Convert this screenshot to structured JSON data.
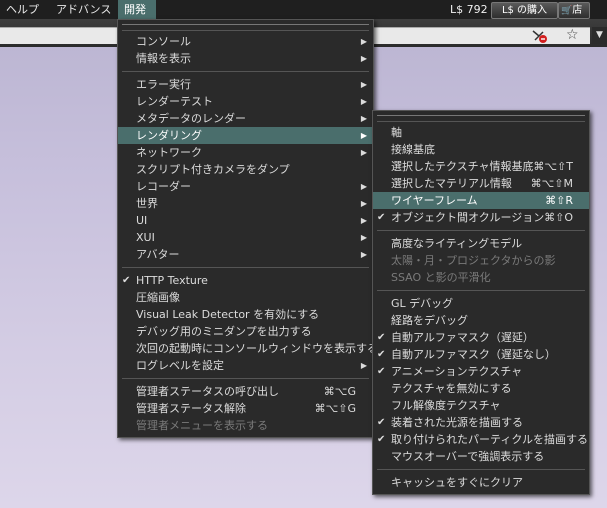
{
  "menubar": {
    "help": "ヘルプ",
    "advanced": "アドバンス",
    "develop": "開発",
    "balance": "L$ 792",
    "buy_label": "L$ の購入",
    "shop_label": "店"
  },
  "dev_menu": {
    "items": [
      {
        "label": "コンソール",
        "submenu": true
      },
      {
        "label": "情報を表示",
        "submenu": true
      },
      {
        "sep": true
      },
      {
        "label": "エラー実行",
        "submenu": true
      },
      {
        "label": "レンダーテスト",
        "submenu": true
      },
      {
        "label": "メタデータのレンダー",
        "submenu": true
      },
      {
        "label": "レンダリング",
        "submenu": true,
        "highlight": true
      },
      {
        "label": "ネットワーク",
        "submenu": true
      },
      {
        "label": "スクリプト付きカメラをダンプ"
      },
      {
        "label": "レコーダー",
        "submenu": true
      },
      {
        "label": "世界",
        "submenu": true
      },
      {
        "label": "UI",
        "submenu": true
      },
      {
        "label": "XUI",
        "submenu": true
      },
      {
        "label": "アバター",
        "submenu": true
      },
      {
        "sep": true
      },
      {
        "label": "HTTP Texture",
        "checked": true
      },
      {
        "label": "圧縮画像"
      },
      {
        "label": "Visual Leak Detector を有効にする"
      },
      {
        "label": "デバッグ用のミニダンプを出力する"
      },
      {
        "label": "次回の起動時にコンソールウィンドウを表示する"
      },
      {
        "label": "ログレベルを設定",
        "submenu": true
      },
      {
        "sep": true
      },
      {
        "label": "管理者ステータスの呼び出し",
        "shortcut": "⌘⌥G"
      },
      {
        "label": "管理者ステータス解除",
        "shortcut": "⌘⌥⇧G"
      },
      {
        "label": "管理者メニューを表示する",
        "disabled": true
      }
    ]
  },
  "render_menu": {
    "items": [
      {
        "label": "軸"
      },
      {
        "label": "接線基底"
      },
      {
        "label": "選択したテクスチャ情報基底",
        "shortcut": "⌘⌥⇧T"
      },
      {
        "label": "選択したマテリアル情報",
        "shortcut": "⌘⌥⇧M"
      },
      {
        "label": "ワイヤーフレーム",
        "shortcut": "⌘⇧R",
        "highlight": true
      },
      {
        "label": "オブジェクト間オクルージョン",
        "shortcut": "⌘⇧O",
        "checked": true
      },
      {
        "sep": true
      },
      {
        "label": "高度なライティングモデル"
      },
      {
        "label": "太陽・月・プロジェクタからの影",
        "disabled": true
      },
      {
        "label": "SSAO と影の平滑化",
        "disabled": true
      },
      {
        "sep": true
      },
      {
        "label": "GL デバッグ"
      },
      {
        "label": "経路をデバッグ"
      },
      {
        "label": "自動アルファマスク（遅延）",
        "checked": true
      },
      {
        "label": "自動アルファマスク（遅延なし）",
        "checked": true
      },
      {
        "label": "アニメーションテクスチャ",
        "checked": true
      },
      {
        "label": "テクスチャを無効にする"
      },
      {
        "label": "フル解像度テクスチャ"
      },
      {
        "label": "装着された光源を描画する",
        "checked": true
      },
      {
        "label": "取り付けられたパーティクルを描画する",
        "checked": true
      },
      {
        "label": "マウスオーバーで強調表示する"
      },
      {
        "sep": true
      },
      {
        "label": "キャッシュをすぐにクリア"
      }
    ]
  },
  "glyphs": {
    "check": "✔",
    "arrow": "▶",
    "dropdown": "▼",
    "star": "☆",
    "cart": "🛒"
  },
  "icons": {
    "no_script": "no-script-icon",
    "favorite": "star-icon",
    "cart": "cart-icon"
  }
}
